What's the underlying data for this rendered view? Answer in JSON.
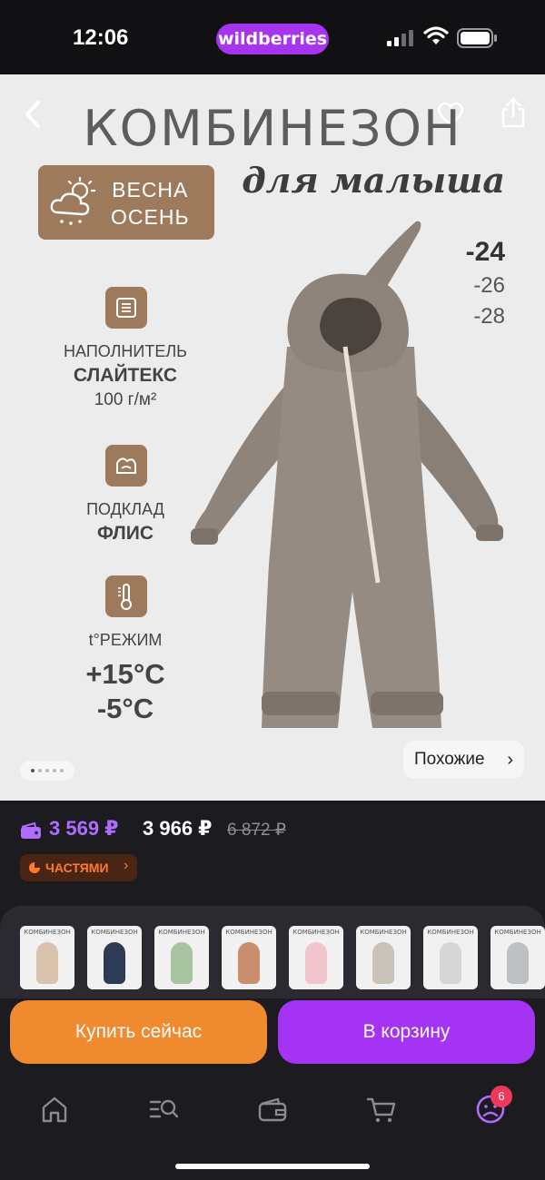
{
  "status_bar": {
    "time": "12:06",
    "brand": "wildberries"
  },
  "gallery": {
    "title": "КОМБИНЕЗОН",
    "subtitle": "для малыша",
    "season": {
      "line1": "ВЕСНА",
      "line2": "ОСЕНЬ"
    },
    "sizes": {
      "main": "-24",
      "others": [
        "-26",
        "-28"
      ]
    },
    "features": [
      {
        "label": "НАПОЛНИТЕЛЬ",
        "strong": "СЛАЙТЕКС",
        "value": "100 г/м²"
      },
      {
        "label": "ПОДКЛАД",
        "strong": "ФЛИС"
      },
      {
        "label": "t°РЕЖИМ",
        "temp_high": "+15°C",
        "temp_low": "-5°C"
      }
    ],
    "similar_label": "Похожие",
    "image_count": 5,
    "current_image": 1
  },
  "price": {
    "wallet_price": "3 569 ₽",
    "price": "3 966 ₽",
    "old_price": "6 872 ₽",
    "installment_label": "ЧАСТЯМИ"
  },
  "thumbnails": [
    {
      "label": "КОМБИНЕЗОН",
      "color": "#d9c3ad"
    },
    {
      "label": "КОМБИНЕЗОН",
      "color": "#2f3b54"
    },
    {
      "label": "КОМБИНЕЗОН",
      "color": "#a9c4a0"
    },
    {
      "label": "КОМБИНЕЗОН",
      "color": "#c98e6e"
    },
    {
      "label": "КОМБИНЕЗОН",
      "color": "#f0c4cc"
    },
    {
      "label": "КОМБИНЕЗОН",
      "color": "#c9c2b8"
    },
    {
      "label": "КОМБИНЕЗОН",
      "color": "#d6d6d4"
    },
    {
      "label": "КОМБИНЕЗОН",
      "color": "#bcc0c2"
    }
  ],
  "actions": {
    "buy_now": "Купить сейчас",
    "add_to_cart": "В корзину"
  },
  "nav": {
    "cart_count": "6"
  },
  "colors": {
    "accent_purple": "#a533f3",
    "accent_orange": "#f08a2e",
    "badge_brown": "#9e7a5c",
    "background_dark": "#1c1b20"
  }
}
